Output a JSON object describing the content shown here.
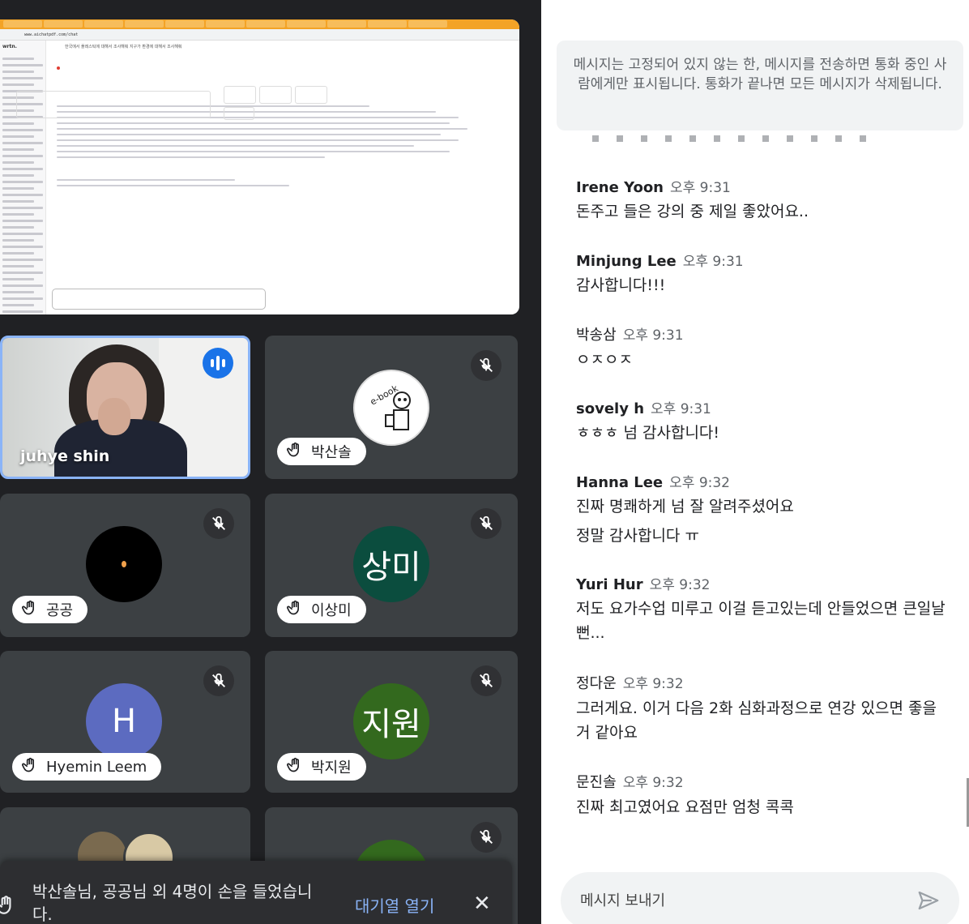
{
  "shared_screen": {
    "url": "www.aichatpdf.com/chat",
    "brand": "wrtn.",
    "title": "한국에서 플레스틱에 대해서 조사해줘 지구가 환경에 대해서 조사해줘"
  },
  "tiles": [
    {
      "id": "juhye",
      "name": "juhye shin"
    },
    {
      "id": "parksansol",
      "chip": "박산솔",
      "avatar_text": "e-book"
    },
    {
      "id": "gonggong",
      "chip": "공공"
    },
    {
      "id": "sangmi",
      "chip": "이상미",
      "avatar_text": "상미",
      "color": "#0b4d3e"
    },
    {
      "id": "hyemin",
      "chip": "Hyemin Leem",
      "avatar_text": "H",
      "color": "#5c6bc0"
    },
    {
      "id": "jiwon",
      "chip": "박지원",
      "avatar_text": "지원",
      "color": "#33691e"
    }
  ],
  "banner": {
    "text": "박산솔님, 공공님 외 4명이 손을 들었습니다.",
    "button": "대기열 열기"
  },
  "chat": {
    "notice": "메시지는 고정되어 있지 않는 한, 메시지를 전송하면 통화 중인 사람에게만 표시됩니다. 통화가 끝나면 모든 메시지가 삭제됩니다.",
    "messages": [
      {
        "sender": "Irene Yoon",
        "time": "오후 9:31",
        "lines": [
          "돈주고 들은 강의 중 제일 좋았어요.."
        ]
      },
      {
        "sender": "Minjung Lee",
        "time": "오후 9:31",
        "lines": [
          "감사합니다!!!"
        ]
      },
      {
        "sender": "박송삼",
        "time": "오후 9:31",
        "lines": [
          "ㅇㅈㅇㅈ"
        ]
      },
      {
        "sender": "sovely h",
        "time": "오후 9:31",
        "lines": [
          "ㅎㅎㅎ 넘 감사합니다!"
        ]
      },
      {
        "sender": "Hanna Lee",
        "time": "오후 9:32",
        "lines": [
          "진짜 명쾌하게 넘 잘 알려주셨어요",
          "정말 감사합니다 ㅠ"
        ]
      },
      {
        "sender": "Yuri Hur",
        "time": "오후 9:32",
        "lines": [
          "저도 요가수업 미루고 이걸 듣고있는데 안들었으면 큰일날뻔..."
        ]
      },
      {
        "sender": "정다운",
        "time": "오후 9:32",
        "lines": [
          "그러게요. 이거 다음 2화 심화과정으로 연강 있으면 좋을 거 같아요"
        ]
      },
      {
        "sender": "문진솔",
        "time": "오후 9:32",
        "lines": [
          "진짜 최고였어요 요점만 엄청 콕콕"
        ]
      }
    ],
    "composer_placeholder": "메시지 보내기"
  },
  "colors": {
    "accent_blue": "#8ab4f8",
    "tile_bg": "#3c4043",
    "stage_bg": "#202124"
  }
}
